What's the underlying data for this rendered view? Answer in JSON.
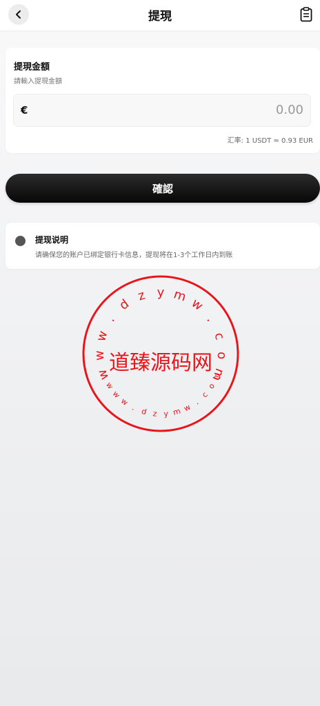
{
  "header": {
    "title": "提現",
    "back_icon": "chevron-left-icon",
    "record_icon": "clipboard-icon"
  },
  "amount_card": {
    "title": "提現金額",
    "hint": "請輸入提現金額",
    "currency_symbol": "€",
    "amount_value": "0.00",
    "rate": "汇率: 1 USDT ≈ 0.93 EUR"
  },
  "confirm_button": {
    "label": "確認"
  },
  "notice": {
    "title": "提现说明",
    "text": "请确保您的账户已绑定银行卡信息，提现将在1-3个工作日内到账"
  },
  "watermark": {
    "center_text": "道臻源码网",
    "url_top": "www.dzymw.com",
    "url_bottom": "www.dzymw.com",
    "color": "#e8151b"
  },
  "colors": {
    "button": "#0a0a0a",
    "stamp": "#e8151b"
  }
}
